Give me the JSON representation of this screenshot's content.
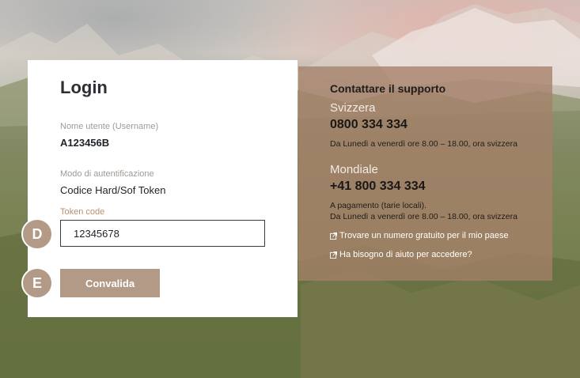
{
  "login": {
    "title": "Login",
    "username_label": "Nome utente (Username)",
    "username_value": "A123456B",
    "auth_mode_label": "Modo di autentificazione",
    "auth_mode_value": "Codice Hard/Sof Token",
    "token_label": "Token code",
    "token_value": "12345678",
    "submit_label": "Convalida"
  },
  "markers": {
    "d": "D",
    "e": "E"
  },
  "support": {
    "title": "Contattare il supporto",
    "switzerland": {
      "region": "Svizzera",
      "phone": "0800 334 334",
      "hours": "Da Lunedì a venerdì ore 8.00 – 18.00, ora svizzera"
    },
    "worldwide": {
      "region": "Mondiale",
      "phone": "+41 800 334 334",
      "note": "A pagamento (tarie locali).",
      "hours": "Da Lunedì a venerdì ore 8.00 – 18.00, ora svizzera"
    },
    "links": [
      {
        "label": "Trovare un numero gratuito per il mio paese",
        "icon": "external-link-icon"
      },
      {
        "label": "Ha bisogno di aiuto per accedere?",
        "icon": "external-link-icon"
      }
    ]
  },
  "colors": {
    "accent": "#b39a86",
    "support_panel": "#a58069"
  }
}
